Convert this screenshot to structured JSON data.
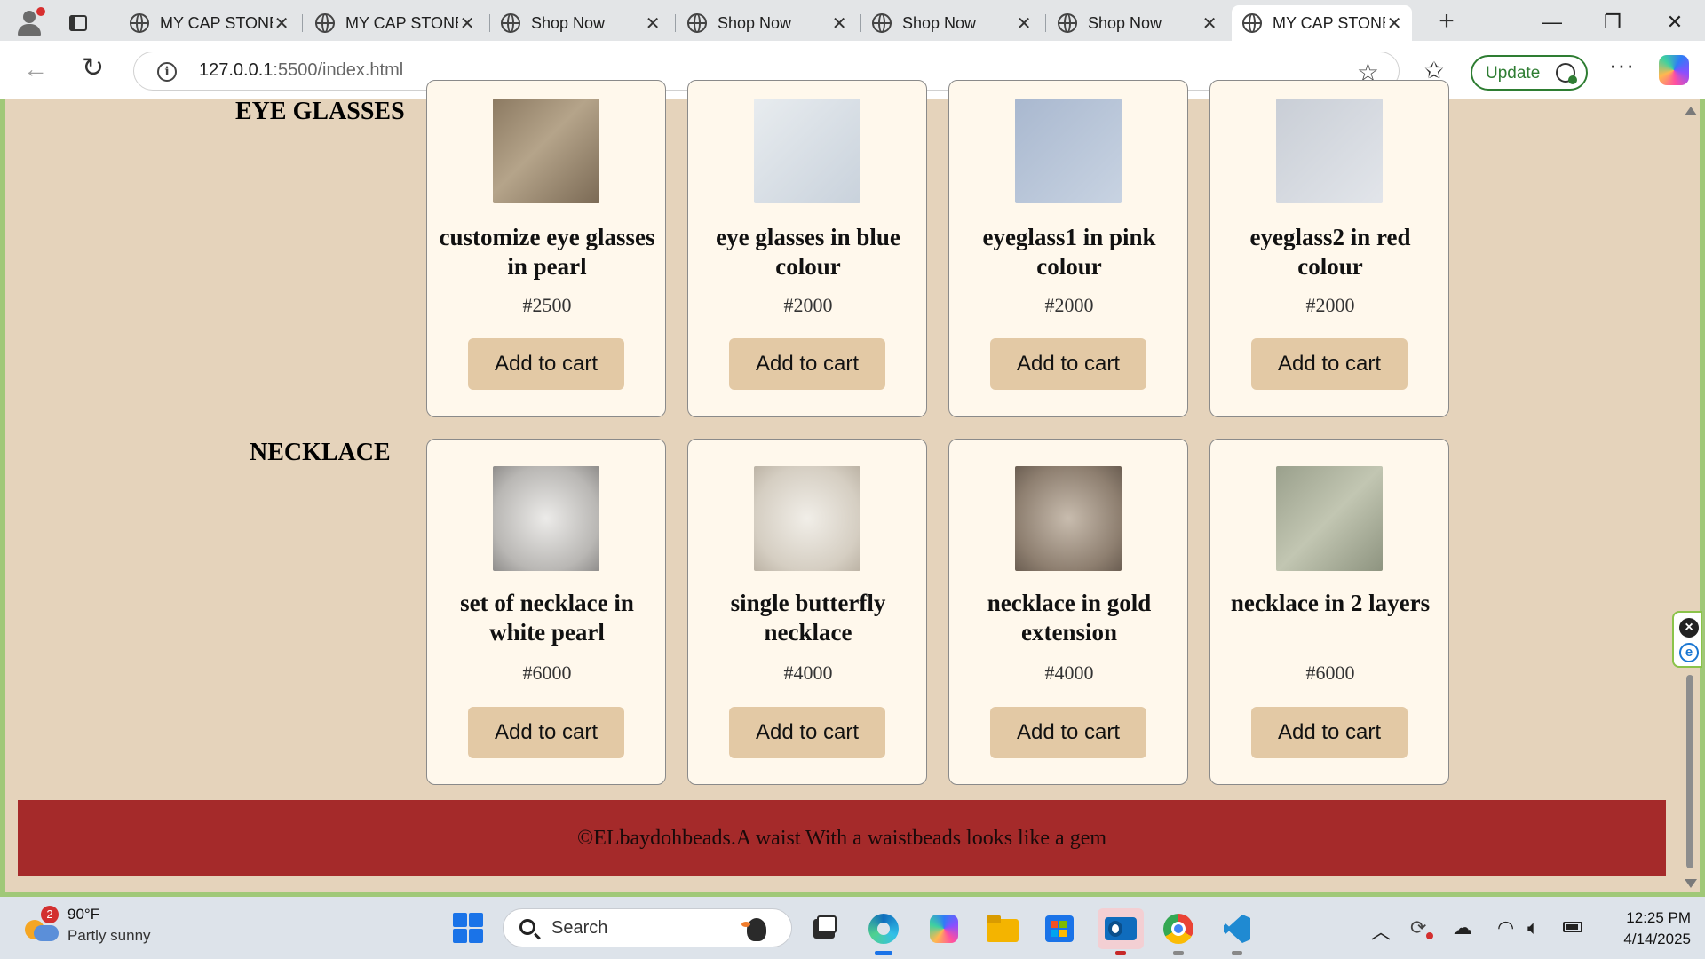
{
  "browser": {
    "tabs": [
      {
        "title": "MY CAP STONE",
        "active": false
      },
      {
        "title": "MY CAP STONE",
        "active": false
      },
      {
        "title": "Shop Now",
        "active": false
      },
      {
        "title": "Shop Now",
        "active": false
      },
      {
        "title": "Shop Now",
        "active": false
      },
      {
        "title": "Shop Now",
        "active": false
      },
      {
        "title": "MY CAP STONE",
        "active": true
      }
    ],
    "new_tab_label": "+",
    "window_controls": {
      "minimize": "—",
      "restore": "❐",
      "close": "✕"
    },
    "address": {
      "host": "127.0.0.1",
      "path": ":5500/index.html"
    },
    "update_label": "Update",
    "more_label": "···"
  },
  "page": {
    "sections": [
      {
        "label": "EYE GLASSES",
        "products": [
          {
            "name": "customize eye glasses in pearl",
            "price": "#2500",
            "button": "Add to cart",
            "image_colors": [
              "#8c7a62",
              "#b5a48a"
            ]
          },
          {
            "name": "eye glasses in blue colour",
            "price": "#2000",
            "button": "Add to cart",
            "image_colors": [
              "#e8ecef",
              "#c9d2dc"
            ]
          },
          {
            "name": "eyeglass1 in pink colour",
            "price": "#2000",
            "button": "Add to cart",
            "image_colors": [
              "#a9b8cf",
              "#c8d3e2"
            ]
          },
          {
            "name": "eyeglass2 in red colour",
            "price": "#2000",
            "button": "Add to cart",
            "image_colors": [
              "#c9ced6",
              "#e2e5ea"
            ]
          }
        ]
      },
      {
        "label": "NECKLACE",
        "products": [
          {
            "name": "set of necklace in white pearl",
            "price": "#6000",
            "button": "Add to cart",
            "image_colors": [
              "#d9d6d2",
              "#9c9a98"
            ]
          },
          {
            "name": "single butterfly necklace",
            "price": "#4000",
            "button": "Add to cart",
            "image_colors": [
              "#e6e2da",
              "#cfc8bb"
            ]
          },
          {
            "name": "necklace in gold extension",
            "price": "#4000",
            "button": "Add to cart",
            "image_colors": [
              "#7d6e60",
              "#b3a696"
            ]
          },
          {
            "name": "necklace in 2 layers",
            "price": "#6000",
            "button": "Add to cart",
            "image_colors": [
              "#9aa08c",
              "#c2c6b2"
            ]
          }
        ]
      }
    ],
    "footer": "©ELbaydohbeads.A waist With a waistbeads looks like a gem",
    "colors": {
      "background": "#e5d3bb",
      "card": "#fff8ec",
      "button": "#e3c9a5",
      "footer": "#a52a2a"
    }
  },
  "taskbar": {
    "weather": {
      "badge": "2",
      "temp": "90°F",
      "condition": "Partly sunny"
    },
    "search_placeholder": "Search",
    "clock": {
      "time": "12:25 PM",
      "date": "4/14/2025"
    }
  }
}
